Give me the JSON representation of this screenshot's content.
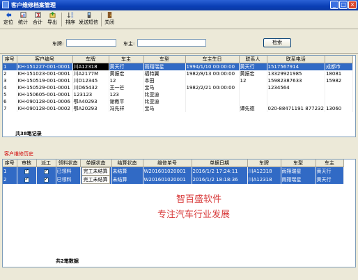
{
  "window": {
    "title": "客户维修档案管理"
  },
  "toolbar": {
    "items": [
      {
        "label": "定位",
        "icon": "locate-icon"
      },
      {
        "label": "统计",
        "icon": "stats-icon"
      },
      {
        "label": "合计",
        "icon": "sum-icon"
      },
      {
        "label": "导出",
        "icon": "export-icon"
      },
      {
        "label": "排序",
        "icon": "sort-icon"
      },
      {
        "label": "发送短信",
        "icon": "sms-icon"
      },
      {
        "label": "关闭",
        "icon": "close-door-icon"
      }
    ]
  },
  "search": {
    "plate_label": "车牌:",
    "owner_label": "车主:",
    "plate_value": "",
    "owner_value": "",
    "button": "检索"
  },
  "customers": {
    "columns": [
      "序号",
      "客户编号",
      "车牌",
      "车主",
      "车型",
      "车主生日",
      "联系人",
      "联系电话",
      ""
    ],
    "rows": [
      [
        "1",
        "KH-151227-001-0001",
        "川A12318",
        "黄天行",
        "雨翔瑞星",
        "1994/1/10 00:00:00",
        "黄天行",
        "1517567914",
        "成都市"
      ],
      [
        "2",
        "KH-151023-001-0001",
        "川A2177M",
        "黄振宏",
        "福特翼",
        "1982/8/13 00:00:00",
        "黄振宏",
        "13329921985",
        "18081"
      ],
      [
        "3",
        "KH-150519-001-0001",
        "川D12345",
        "12",
        "本田",
        "",
        "12",
        "15982387633",
        "15982"
      ],
      [
        "4",
        "KH-150529-001-0001",
        "川D65432",
        "王一芒",
        "宝马",
        "1982/2/21 00:00:00",
        "",
        "1234564",
        ""
      ],
      [
        "5",
        "KH-150605-001-0001",
        "123123",
        "123",
        "比亚迪",
        "",
        "",
        "",
        ""
      ],
      [
        "6",
        "KH-090128-001-0006",
        "鄂A40293",
        "谢教平",
        "比亚迪",
        "",
        "",
        "",
        ""
      ],
      [
        "7",
        "KH-090128-001-0002",
        "鄂A20293",
        "冯先祥",
        "宝马",
        "",
        "谭先德",
        "020-88471191 877232",
        "13060"
      ]
    ],
    "summary": "共38笔记录"
  },
  "history": {
    "section_title": "客户维修历史",
    "columns": [
      "序号",
      "审核",
      "派工",
      "领料状态",
      "单据状态",
      "结算状态",
      "维修单号",
      "单据日期",
      "车牌",
      "车型",
      "车主"
    ],
    "rows": [
      {
        "no": "1",
        "audit": true,
        "dispatch": true,
        "material": "已领料",
        "doc_status": "完工未结算",
        "settle": "未结算",
        "order_no": "W201601020001",
        "date": "2016/1/2 17:24:11",
        "plate": "川A12318",
        "model": "雨翔瑞星",
        "owner": "黄天行"
      },
      {
        "no": "2",
        "audit": true,
        "dispatch": true,
        "material": "已领料",
        "doc_status": "完工未结算",
        "settle": "未结算",
        "order_no": "W201601020001",
        "date": "2016/1/2 18:18:36",
        "plate": "川A12318",
        "model": "雨翔瑞星",
        "owner": "黄天行"
      }
    ],
    "summary": "共2笔数据"
  },
  "watermark": {
    "line1": "智百盛软件",
    "line2": "专注汽车行业发展"
  },
  "colors": {
    "selection": "#316ac5",
    "title_bar": "#0a3fb5",
    "watermark": "#d83a3a"
  }
}
